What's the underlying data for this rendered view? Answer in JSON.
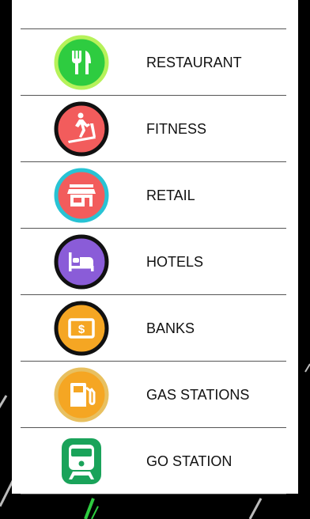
{
  "legend": {
    "items": [
      {
        "label": "RESTAURANT",
        "icon": "fork-knife-icon",
        "fill": "#2ecc40",
        "ring": "#b6f25a"
      },
      {
        "label": "FITNESS",
        "icon": "treadmill-icon",
        "fill": "#f25c5c",
        "ring": "#111111"
      },
      {
        "label": "RETAIL",
        "icon": "store-icon",
        "fill": "#f25c5c",
        "ring": "#28c3d4"
      },
      {
        "label": "HOTELS",
        "icon": "bed-icon",
        "fill": "#8a5cd8",
        "ring": "#111111"
      },
      {
        "label": "BANKS",
        "icon": "dollar-bill-icon",
        "fill": "#f5a623",
        "ring": "#111111"
      },
      {
        "label": "GAS STATIONS",
        "icon": "fuel-pump-icon",
        "fill": "#f5a623",
        "ring": "#e8c060"
      },
      {
        "label": "GO STATION",
        "icon": "train-icon",
        "fill": "#1aa35a",
        "ring": "#1aa35a"
      }
    ]
  }
}
